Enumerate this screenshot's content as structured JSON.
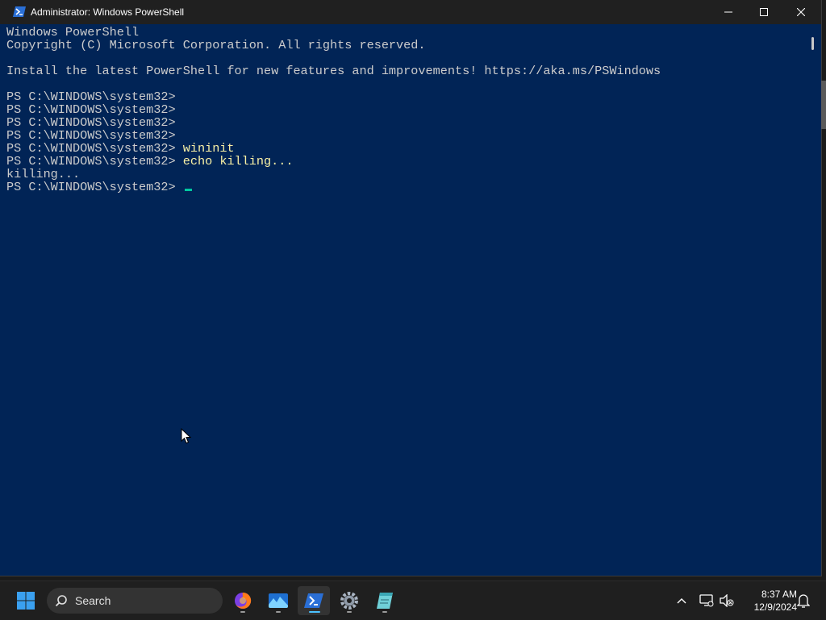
{
  "window": {
    "title": "Administrator: Windows PowerShell"
  },
  "console": {
    "lines": [
      {
        "text": "Windows PowerShell"
      },
      {
        "text": "Copyright (C) Microsoft Corporation. All rights reserved."
      },
      {
        "text": ""
      },
      {
        "text": "Install the latest PowerShell for new features and improvements! https://aka.ms/PSWindows"
      },
      {
        "text": ""
      },
      {
        "prompt": "PS C:\\WINDOWS\\system32>",
        "cmd": ""
      },
      {
        "prompt": "PS C:\\WINDOWS\\system32>",
        "cmd": ""
      },
      {
        "prompt": "PS C:\\WINDOWS\\system32>",
        "cmd": ""
      },
      {
        "prompt": "PS C:\\WINDOWS\\system32>",
        "cmd": ""
      },
      {
        "prompt": "PS C:\\WINDOWS\\system32>",
        "cmd": "wininit"
      },
      {
        "prompt": "PS C:\\WINDOWS\\system32>",
        "cmd": "echo killing..."
      },
      {
        "text": "killing..."
      },
      {
        "prompt": "PS C:\\WINDOWS\\system32>",
        "cmd": "",
        "cursor": true
      }
    ]
  },
  "taskbar": {
    "search_label": "Search",
    "apps": [
      {
        "name": "firefox-icon"
      },
      {
        "name": "photos-icon"
      },
      {
        "name": "powershell-icon",
        "active": true
      },
      {
        "name": "settings-icon"
      },
      {
        "name": "notepad-icon"
      }
    ],
    "clock": {
      "time": "8:37 AM",
      "date": "12/9/2024"
    }
  },
  "colors": {
    "console_bg": "#012456",
    "console_text": "#cccccc",
    "command_text": "#f9f1a5",
    "taskbar_bg": "#1f1f1f"
  }
}
